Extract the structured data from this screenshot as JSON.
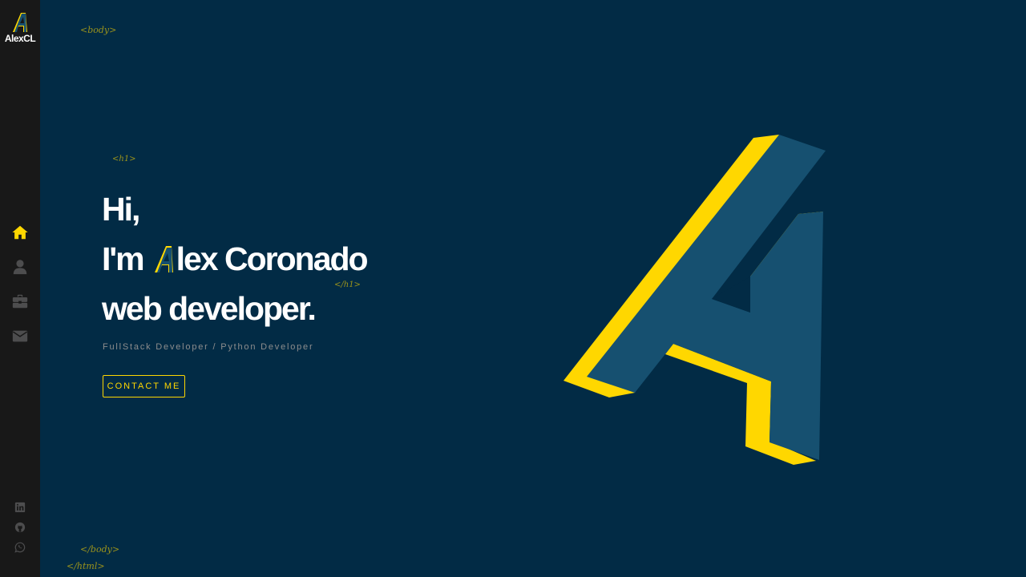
{
  "brand": {
    "name": "AlexCL",
    "logo_icon": "a-logo-icon"
  },
  "nav": [
    {
      "name": "home",
      "icon": "home-icon",
      "active": true
    },
    {
      "name": "about",
      "icon": "user-icon",
      "active": false
    },
    {
      "name": "portfolio",
      "icon": "briefcase-icon",
      "active": false
    },
    {
      "name": "contact",
      "icon": "envelope-icon",
      "active": false
    }
  ],
  "social": [
    {
      "name": "linkedin",
      "icon": "linkedin-icon"
    },
    {
      "name": "github",
      "icon": "github-icon"
    },
    {
      "name": "whatsapp",
      "icon": "whatsapp-icon"
    }
  ],
  "tags": {
    "body_open": "<body>",
    "h1_open": "<h1>",
    "h1_close": "</h1>",
    "body_close": "</body>",
    "html_close": "</html>"
  },
  "hero": {
    "line1": "Hi,",
    "line2_prefix": "I'm",
    "line2_rest": "lex Coronado",
    "line3": "web developer.",
    "subtitle": "FullStack Developer / Python Developer",
    "cta_label": "CONTACT ME"
  },
  "colors": {
    "background": "#022b45",
    "sidebar": "#181818",
    "accent": "#ffd700",
    "logo_face": "#165070",
    "nav_inactive": "#4d4d4e"
  }
}
